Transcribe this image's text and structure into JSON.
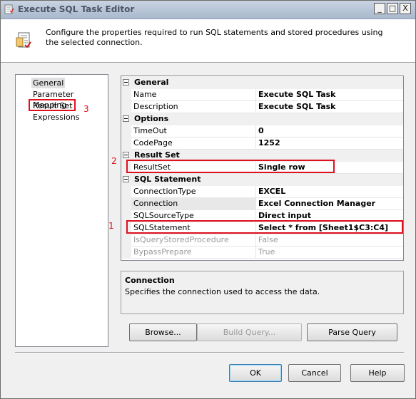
{
  "window": {
    "title": "Execute SQL Task Editor",
    "controls": {
      "minimize": "_",
      "maximize": "□",
      "close": "X"
    }
  },
  "header": {
    "text": "Configure the properties required to run SQL statements and stored procedures using the selected connection.",
    "icon": "task-icon"
  },
  "nav": {
    "items": [
      {
        "label": "General",
        "selected": true
      },
      {
        "label": "Parameter Mapping",
        "selected": false
      },
      {
        "label": "Result Set",
        "selected": false
      },
      {
        "label": "Expressions",
        "selected": false
      }
    ]
  },
  "annotations": {
    "one": "1",
    "two": "2",
    "three": "3",
    "color": "#e0101f"
  },
  "grid": {
    "general": {
      "label": "General",
      "rows": [
        {
          "name": "Name",
          "value": "Execute SQL Task"
        },
        {
          "name": "Description",
          "value": "Execute SQL Task"
        }
      ]
    },
    "options": {
      "label": "Options",
      "rows": [
        {
          "name": "TimeOut",
          "value": "0"
        },
        {
          "name": "CodePage",
          "value": "1252"
        }
      ]
    },
    "result_set": {
      "label": "Result Set",
      "rows": [
        {
          "name": "ResultSet",
          "value": "Single row"
        }
      ]
    },
    "sql_statement": {
      "label": "SQL Statement",
      "rows": [
        {
          "name": "ConnectionType",
          "value": "EXCEL"
        },
        {
          "name": "Connection",
          "value": "Excel Connection Manager"
        },
        {
          "name": "SQLSourceType",
          "value": "Direct input"
        },
        {
          "name": "SQLStatement",
          "value": "Select * from [Sheet1$C3:C4]"
        },
        {
          "name": "IsQueryStoredProcedure",
          "value": "False"
        },
        {
          "name": "BypassPrepare",
          "value": "True"
        }
      ]
    }
  },
  "description": {
    "title": "Connection",
    "text": "Specifies the connection used to access the data."
  },
  "buttons": {
    "browse": "Browse...",
    "build_query": "Build Query...",
    "parse_query": "Parse Query",
    "ok": "OK",
    "cancel": "Cancel",
    "help": "Help"
  }
}
